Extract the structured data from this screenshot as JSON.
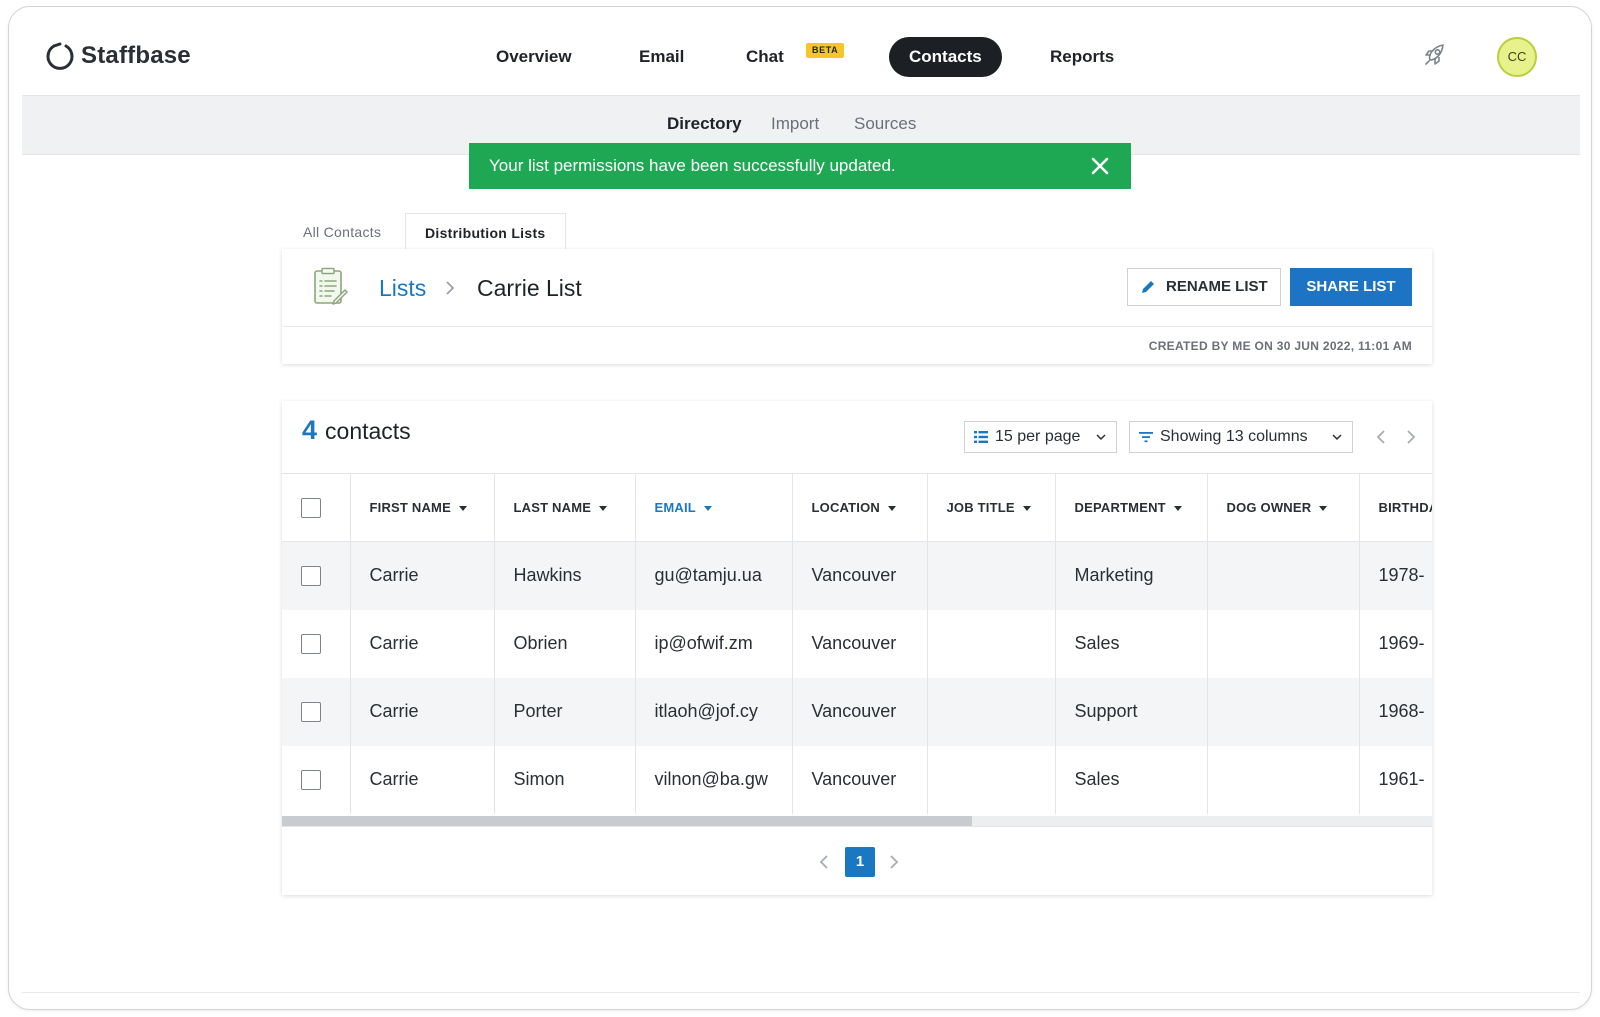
{
  "brand": {
    "name": "Staffbase"
  },
  "nav": {
    "items": [
      {
        "label": "Overview"
      },
      {
        "label": "Email"
      },
      {
        "label": "Chat",
        "badge": "BETA"
      },
      {
        "label": "Contacts",
        "active": true
      },
      {
        "label": "Reports"
      }
    ]
  },
  "user": {
    "initials": "CC"
  },
  "subnav": {
    "items": [
      "Directory",
      "Import",
      "Sources"
    ],
    "active": "Directory"
  },
  "toast": {
    "message": "Your list permissions have been successfully updated."
  },
  "tabs": {
    "items": [
      "All Contacts",
      "Distribution Lists"
    ],
    "active": "Distribution Lists"
  },
  "list_header": {
    "breadcrumb_root": "Lists",
    "breadcrumb_current": "Carrie List",
    "rename_label": "RENAME LIST",
    "share_label": "SHARE LIST",
    "created_text": "CREATED BY ME ON 30 JUN 2022, 11:01 AM"
  },
  "contacts": {
    "count": "4",
    "count_label": "contacts",
    "per_page": "15 per page",
    "columns_label": "Showing 13 columns",
    "headers": [
      "FIRST NAME",
      "LAST NAME",
      "EMAIL",
      "LOCATION",
      "JOB TITLE",
      "DEPARTMENT",
      "DOG OWNER",
      "BIRTHDA"
    ],
    "sorted_column": "EMAIL",
    "rows": [
      {
        "first": "Carrie",
        "last": "Hawkins",
        "email": "gu@tamju.ua",
        "location": "Vancouver",
        "job": "",
        "department": "Marketing",
        "dog": "",
        "birthday": "1978-"
      },
      {
        "first": "Carrie",
        "last": "Obrien",
        "email": "ip@ofwif.zm",
        "location": "Vancouver",
        "job": "",
        "department": "Sales",
        "dog": "",
        "birthday": "1969-"
      },
      {
        "first": "Carrie",
        "last": "Porter",
        "email": "itlaoh@jof.cy",
        "location": "Vancouver",
        "job": "",
        "department": "Support",
        "dog": "",
        "birthday": "1968-"
      },
      {
        "first": "Carrie",
        "last": "Simon",
        "email": "vilnon@ba.gw",
        "location": "Vancouver",
        "job": "",
        "department": "Sales",
        "dog": "",
        "birthday": "1961-"
      }
    ],
    "current_page": "1"
  },
  "colors": {
    "accent": "#1a78c2",
    "success": "#1ea853",
    "active_nav": "#1c1f23",
    "beta": "#f7c52a"
  },
  "icons": [
    "staffbase-logo-icon",
    "rocket-icon",
    "close-icon",
    "list-document-icon",
    "pencil-icon",
    "list-icon",
    "filter-icon",
    "chevron-down-icon",
    "chevron-left-icon",
    "chevron-right-icon",
    "sort-caret-icon"
  ]
}
